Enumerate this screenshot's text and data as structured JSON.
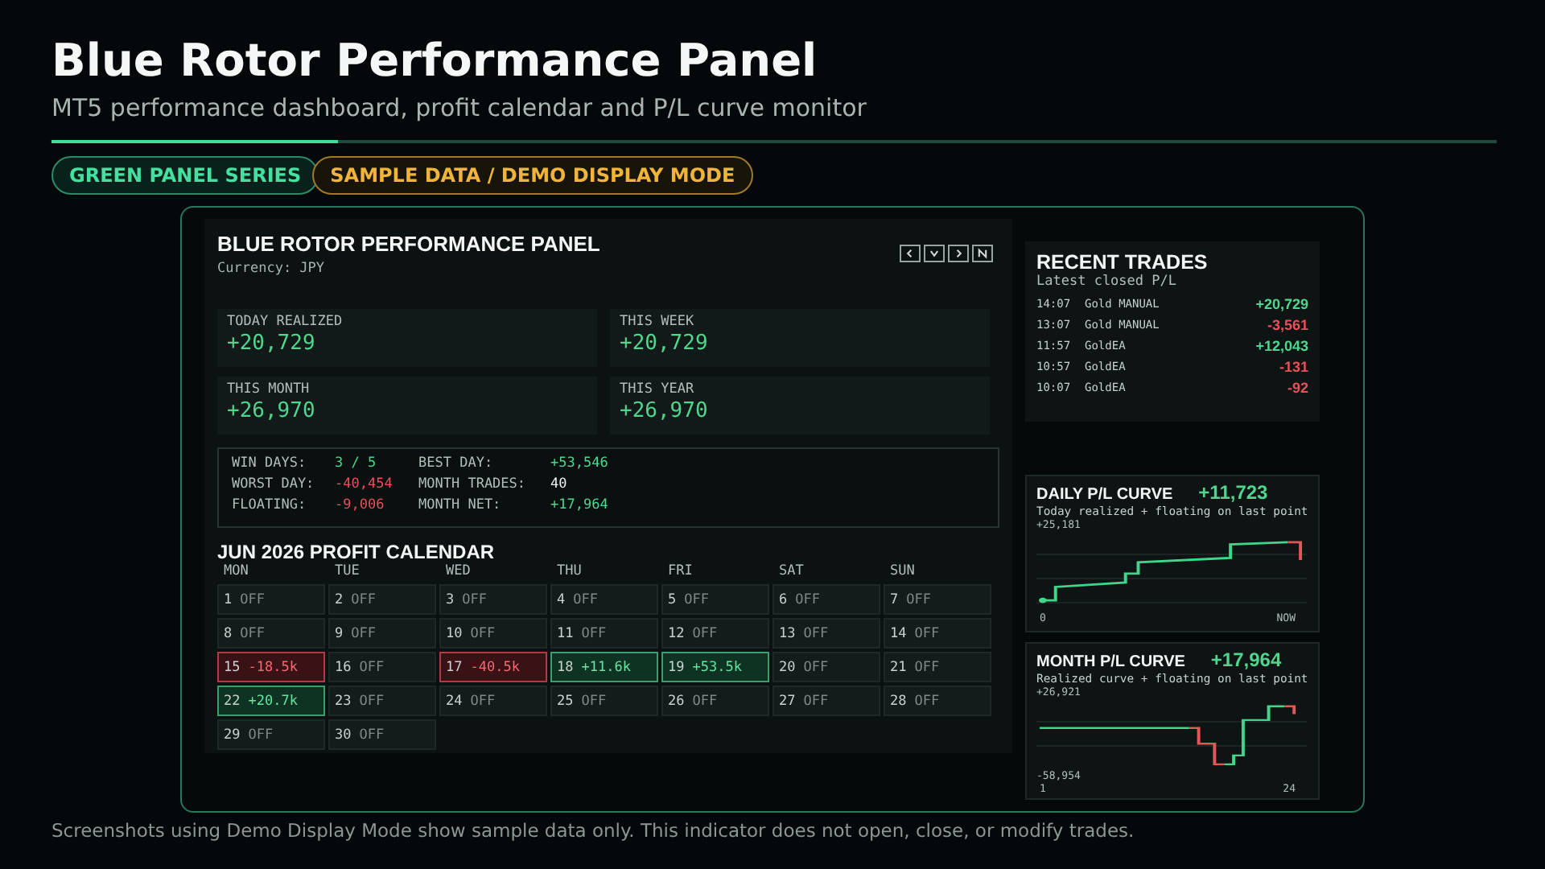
{
  "header": {
    "title": "Blue Rotor Performance Panel",
    "subtitle": "MT5 performance dashboard, profit calendar and P/L curve monitor"
  },
  "badges": [
    {
      "label": "GREEN PANEL SERIES",
      "kind": "series"
    },
    {
      "label": "SAMPLE DATA / DEMO DISPLAY MODE",
      "kind": "mode"
    }
  ],
  "panel": {
    "title": "BLUE ROTOR PERFORMANCE PANEL",
    "currency": "Currency: JPY"
  },
  "summary": [
    {
      "label": "TODAY REALIZED",
      "value": "+20,729",
      "kind": "gain"
    },
    {
      "label": "THIS WEEK",
      "value": "+20,729",
      "kind": "gain"
    },
    {
      "label": "THIS MONTH",
      "value": "+26,970",
      "kind": "gain"
    },
    {
      "label": "THIS YEAR",
      "value": "+26,970",
      "kind": "gain"
    }
  ],
  "stats": [
    {
      "label": "WIN DAYS:",
      "value": "3 / 5",
      "kind": "gain"
    },
    {
      "label": "BEST DAY:",
      "value": "+53,546",
      "kind": "gain"
    },
    {
      "label": "WORST DAY:",
      "value": "-40,454",
      "kind": "loss"
    },
    {
      "label": "MONTH TRADES:",
      "value": "40",
      "kind": "count"
    },
    {
      "label": "FLOATING:",
      "value": "-9,006",
      "kind": "loss"
    },
    {
      "label": "MONTH NET:",
      "value": "+17,964",
      "kind": "gain"
    }
  ],
  "calendar": {
    "title": "JUN 2026  PROFIT CALENDAR",
    "weekdays": [
      "MON",
      "TUE",
      "WED",
      "THU",
      "FRI",
      "SAT",
      "SUN"
    ],
    "days": [
      {
        "day": "1",
        "value": "OFF",
        "kind": "off"
      },
      {
        "day": "2",
        "value": "OFF",
        "kind": "off"
      },
      {
        "day": "3",
        "value": "OFF",
        "kind": "off"
      },
      {
        "day": "4",
        "value": "OFF",
        "kind": "off"
      },
      {
        "day": "5",
        "value": "OFF",
        "kind": "off"
      },
      {
        "day": "6",
        "value": "OFF",
        "kind": "off"
      },
      {
        "day": "7",
        "value": "OFF",
        "kind": "off"
      },
      {
        "day": "8",
        "value": "OFF",
        "kind": "off"
      },
      {
        "day": "9",
        "value": "OFF",
        "kind": "off"
      },
      {
        "day": "10",
        "value": "OFF",
        "kind": "off"
      },
      {
        "day": "11",
        "value": "OFF",
        "kind": "off"
      },
      {
        "day": "12",
        "value": "OFF",
        "kind": "off"
      },
      {
        "day": "13",
        "value": "OFF",
        "kind": "off"
      },
      {
        "day": "14",
        "value": "OFF",
        "kind": "off"
      },
      {
        "day": "15",
        "value": "-18.5k",
        "kind": "loss"
      },
      {
        "day": "16",
        "value": "OFF",
        "kind": "off"
      },
      {
        "day": "17",
        "value": "-40.5k",
        "kind": "loss"
      },
      {
        "day": "18",
        "value": "+11.6k",
        "kind": "gain"
      },
      {
        "day": "19",
        "value": "+53.5k",
        "kind": "gain"
      },
      {
        "day": "20",
        "value": "OFF",
        "kind": "off"
      },
      {
        "day": "21",
        "value": "OFF",
        "kind": "off"
      },
      {
        "day": "22",
        "value": "+20.7k",
        "kind": "gain"
      },
      {
        "day": "23",
        "value": "OFF",
        "kind": "off"
      },
      {
        "day": "24",
        "value": "OFF",
        "kind": "off"
      },
      {
        "day": "25",
        "value": "OFF",
        "kind": "off"
      },
      {
        "day": "26",
        "value": "OFF",
        "kind": "off"
      },
      {
        "day": "27",
        "value": "OFF",
        "kind": "off"
      },
      {
        "day": "28",
        "value": "OFF",
        "kind": "off"
      },
      {
        "day": "29",
        "value": "OFF",
        "kind": "off"
      },
      {
        "day": "30",
        "value": "OFF",
        "kind": "off"
      }
    ]
  },
  "recent_trades": {
    "title": "RECENT TRADES",
    "subtitle": "Latest closed P/L",
    "rows": [
      {
        "time": "14:07",
        "symbol": "Gold MANUAL",
        "pl": "+20,729",
        "kind": "gain"
      },
      {
        "time": "13:07",
        "symbol": "Gold MANUAL",
        "pl": "-3,561",
        "kind": "loss"
      },
      {
        "time": "11:57",
        "symbol": "GoldEA",
        "pl": "+12,043",
        "kind": "gain"
      },
      {
        "time": "10:57",
        "symbol": "GoldEA",
        "pl": "-131",
        "kind": "loss"
      },
      {
        "time": "10:07",
        "symbol": "GoldEA",
        "pl": "-92",
        "kind": "loss"
      }
    ]
  },
  "curves": [
    {
      "kind": "daily",
      "title": "DAILY P/L CURVE",
      "value": "+11,723",
      "note": "Today realized + floating on last point",
      "y_max": "+25,181",
      "x_start": "0",
      "x_end": "NOW"
    },
    {
      "kind": "month",
      "title": "MONTH P/L CURVE",
      "value": "+17,964",
      "note": "Realized curve + floating on last point",
      "y_max": "+26,921",
      "y_min": "-58,954",
      "x_start": "1",
      "x_end": "24"
    }
  ],
  "footer": "Screenshots using Demo Display Mode show sample data only. This indicator does not open, close, or modify trades."
}
